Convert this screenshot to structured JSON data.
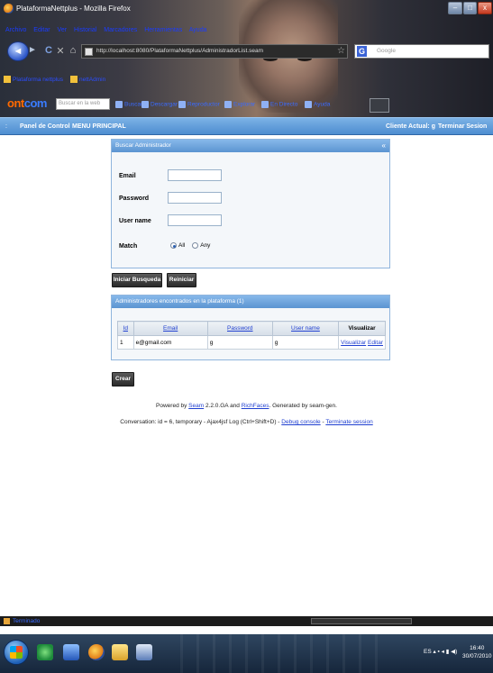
{
  "window": {
    "title": "PlataformaNettplus - Mozilla Firefox",
    "min": "–",
    "max": "□",
    "close": "x"
  },
  "menu": [
    "Archivo",
    "Editar",
    "Ver",
    "Historial",
    "Marcadores",
    "Herramientas",
    "Ayuda"
  ],
  "nav": {
    "url": "http://localhost:8080/PlataformaNettplus/AdministradorList.seam",
    "search_placeholder": "Google"
  },
  "bookmarks": [
    "Plataforma nettplus",
    "nettAdmin"
  ],
  "toolbar": {
    "logo_a": "ont",
    "logo_b": "com",
    "search_placeholder": "Buscar en la web",
    "items": [
      "Buscar",
      "Descargar",
      "Reproductor",
      "Explorar",
      "En Directo",
      "Ayuda"
    ]
  },
  "appnav": {
    "left": [
      "Panel de Control",
      "MENU PRINCIPAL"
    ],
    "client": "Cliente Actual: g",
    "logout": "Terminar Sesion"
  },
  "search": {
    "title": "Buscar Administrador",
    "collapse": "«",
    "fields": [
      {
        "label": "Email",
        "value": ""
      },
      {
        "label": "Password",
        "value": ""
      },
      {
        "label": "User name",
        "value": ""
      }
    ],
    "match_label": "Match",
    "match_options": [
      "All",
      "Any"
    ],
    "match_selected": "All"
  },
  "buttons": {
    "search": "Iniciar Busqueda",
    "reset": "Reiniciar",
    "create": "Crear"
  },
  "results": {
    "title": "Administradores encontrados en la plataforma (1)",
    "columns": [
      "Id",
      "Email",
      "Password",
      "User name",
      "Visualizar"
    ],
    "rows": [
      {
        "id": "1",
        "email": "e@gmail.com",
        "password": "g",
        "username": "g",
        "view": "Visualizar",
        "edit": "Editar"
      }
    ]
  },
  "footer": {
    "powered_pre": "Powered by",
    "seam": "Seam",
    "powered_mid": "2.2.0.GA and",
    "richfaces": "RichFaces",
    "powered_post": ". Generated by seam-gen.",
    "conversation": "Conversation: id = 6, temporary - Ajax4jsf Log (Ctrl+Shift+D) -",
    "debug": "Debug console",
    "dash": "-",
    "terminate": "Terminate session"
  },
  "status": {
    "text": "Terminado"
  },
  "taskbar": {
    "lang": "ES",
    "time": "16:40",
    "date": "30/07/2010"
  }
}
